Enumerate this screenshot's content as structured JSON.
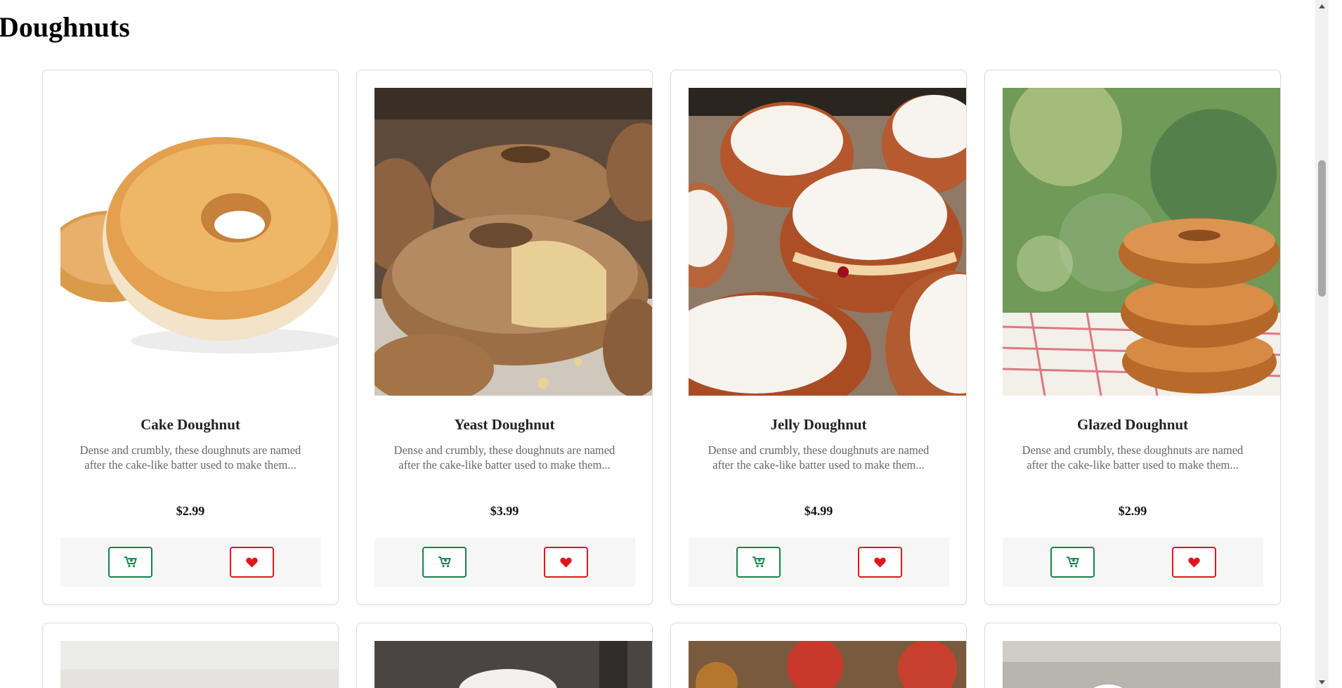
{
  "page": {
    "title": "Doughnuts"
  },
  "products": [
    {
      "name": "Cake Doughnut",
      "description": "Dense and crumbly, these doughnuts are named after the cake-like batter used to make them...",
      "price": "$2.99",
      "image": "cake-doughnut-photo"
    },
    {
      "name": "Yeast Doughnut",
      "description": "Dense and crumbly, these doughnuts are named after the cake-like batter used to make them...",
      "price": "$3.99",
      "image": "yeast-doughnut-photo"
    },
    {
      "name": "Jelly Doughnut",
      "description": "Dense and crumbly, these doughnuts are named after the cake-like batter used to make them...",
      "price": "$4.99",
      "image": "jelly-doughnut-photo"
    },
    {
      "name": "Glazed Doughnut",
      "description": "Dense and crumbly, these doughnuts are named after the cake-like batter used to make them...",
      "price": "$2.99",
      "image": "glazed-doughnut-photo"
    }
  ],
  "actions": {
    "cart_icon": "cart-plus-icon",
    "favorite_icon": "heart-icon"
  },
  "colors": {
    "cart_accent": "#13854a",
    "favorite_accent": "#e1161b",
    "actions_background": "#f6f6f6"
  }
}
